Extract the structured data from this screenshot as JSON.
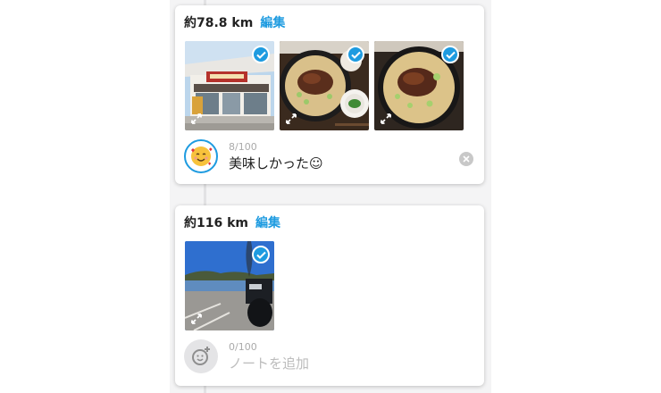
{
  "cards": [
    {
      "distance": "約78.8 km",
      "edit_label": "編集",
      "photos": [
        {
          "name": "restaurant-exterior-photo",
          "selected": true
        },
        {
          "name": "noodle-bowl-side-dish-photo",
          "selected": true
        },
        {
          "name": "noodle-bowl-photo",
          "selected": true
        }
      ],
      "note_counter": "8/100",
      "note_text": "美味しかった☺"
    },
    {
      "distance": "約116 km",
      "edit_label": "編集",
      "photos": [
        {
          "name": "motorcycle-lakeside-photo",
          "selected": true
        }
      ],
      "note_counter": "0/100",
      "note_placeholder": "ノートを追加"
    }
  ],
  "colors": {
    "accent": "#1e9be0",
    "background": "#f4f4f5",
    "placeholder": "#bcbcbc"
  },
  "icons": [
    "check-icon",
    "expand-icon",
    "smiling-face-hearts-icon",
    "add-emoji-icon",
    "clear-icon"
  ]
}
